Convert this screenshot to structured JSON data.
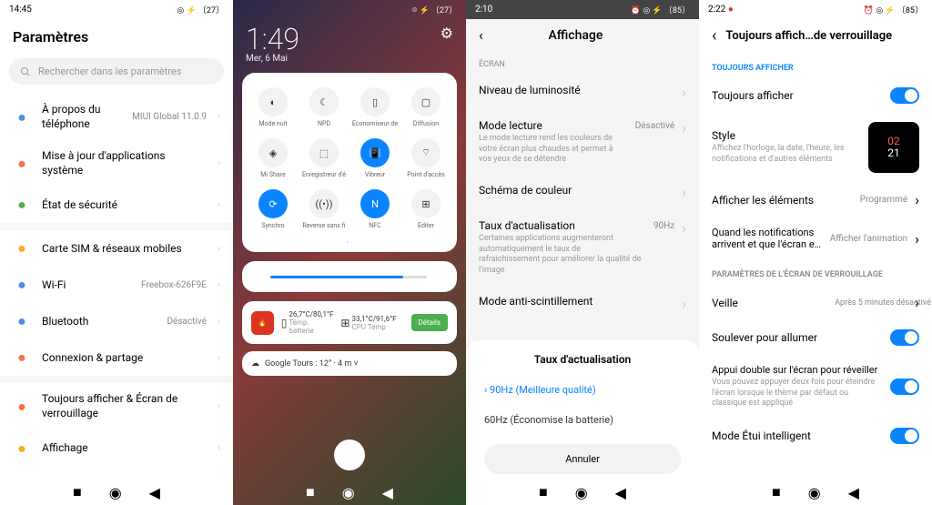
{
  "p1": {
    "time": "14:45",
    "title": "Paramètres",
    "search_ph": "Rechercher dans les paramètres",
    "rows": [
      {
        "icon": "phone",
        "color": "#4a90e2",
        "lbl": "À propos du téléphone",
        "val": "MIUI Global 11.0.9"
      },
      {
        "icon": "up",
        "color": "#ff6b4a",
        "lbl": "Mise à jour d'applications système",
        "val": ""
      },
      {
        "icon": "shield",
        "color": "#4caf50",
        "lbl": "État de sécurité",
        "val": ""
      }
    ],
    "rows2": [
      {
        "icon": "sim",
        "color": "#ffa726",
        "lbl": "Carte SIM & réseaux mobiles",
        "val": ""
      },
      {
        "icon": "wifi",
        "color": "#4a90e2",
        "lbl": "Wi-Fi",
        "val": "Freebox-626F9E"
      },
      {
        "icon": "bt",
        "color": "#4a90e2",
        "lbl": "Bluetooth",
        "val": "Désactivé"
      },
      {
        "icon": "share",
        "color": "#ff6b4a",
        "lbl": "Connexion & partage",
        "val": ""
      }
    ],
    "rows3": [
      {
        "icon": "lock",
        "color": "#ff6b4a",
        "lbl": "Toujours afficher & Écran de verrouillage",
        "val": ""
      },
      {
        "icon": "sun",
        "color": "#ffa726",
        "lbl": "Affichage",
        "val": ""
      }
    ]
  },
  "p2": {
    "time": "1:49",
    "date": "Mer, 6 Mai",
    "status_icons": "⌾ ⚡ 〔27〕",
    "tiles": [
      {
        "l": "Mode nuit",
        "on": false,
        "g": "◐"
      },
      {
        "l": "NPD",
        "on": false,
        "g": "☾"
      },
      {
        "l": "Économiseur de",
        "on": false,
        "g": "▯"
      },
      {
        "l": "Diffusion",
        "on": false,
        "g": "▢"
      },
      {
        "l": "Mi Share",
        "on": false,
        "g": "◈"
      },
      {
        "l": "Enregistreur d'é",
        "on": false,
        "g": "⬚"
      },
      {
        "l": "Vibreur",
        "on": true,
        "g": "📳"
      },
      {
        "l": "Point d'accès",
        "on": false,
        "g": "⌔"
      },
      {
        "l": "Synchro",
        "on": true,
        "g": "⟳"
      },
      {
        "l": "Reverse sans fi",
        "on": false,
        "g": "((•))"
      },
      {
        "l": "NFC",
        "on": true,
        "g": "N"
      },
      {
        "l": "Éditer",
        "on": false,
        "g": "⊞"
      }
    ],
    "temp1": "26,7°C/80,1°F",
    "temp1l": "Temp. batterie",
    "temp2": "33,1°C/91,6°F",
    "temp2l": "CPU Temp",
    "det": "Détails",
    "goog": "Google Tours : 12° · 4 m ˅"
  },
  "p3": {
    "time": "2:10",
    "title": "Affichage",
    "sect": "ÉCRAN",
    "rows": [
      {
        "lbl": "Niveau de luminosité",
        "desc": "",
        "val": ""
      },
      {
        "lbl": "Mode lecture",
        "desc": "Le mode lecture rend les couleurs de votre écran plus chaudes et permet à vos yeux de se détendre",
        "val": "Désactivé"
      },
      {
        "lbl": "Schéma de couleur",
        "desc": "",
        "val": ""
      },
      {
        "lbl": "Taux d'actualisation",
        "desc": "Certaines applications augmenteront automatiquement le taux de rafraichissement pour améliorer la qualité de l'image",
        "val": "90Hz"
      },
      {
        "lbl": "Mode anti-scintillement",
        "desc": "",
        "val": ""
      }
    ],
    "sheet_t": "Taux d'actualisation",
    "opt1": "90Hz (Meilleure qualité)",
    "opt2": "60Hz (Économise la batterie)",
    "cancel": "Annuler"
  },
  "p4": {
    "time": "2:22",
    "title": "Toujours affich…de verrouillage",
    "sect1": "TOUJOURS AFFICHER",
    "r1": "Toujours afficher",
    "r2": "Style",
    "r2d": "Affichez l'horloge, la date, l'heure, les notifications et d'autres éléments",
    "prev1": "02",
    "prev2": "21",
    "r3": "Afficher les éléments",
    "r3v": "Programmé",
    "r4": "Quand les notifications arrivent et que l'écran e…",
    "r4v": "Afficher l'animation",
    "sect2": "PARAMÈTRES DE L'ÉCRAN DE VERROUILLAGE",
    "r5": "Veille",
    "r5v": "Après 5 minutes désactivé",
    "r6": "Soulever pour allumer",
    "r7": "Appui double sur l'écran pour réveiller",
    "r7d": "Vous pouvez appuyer deux fois pour éteindre l'écran lorsque le thème par défaut ou classique est appliqué",
    "r8": "Mode Étui intelligent"
  }
}
